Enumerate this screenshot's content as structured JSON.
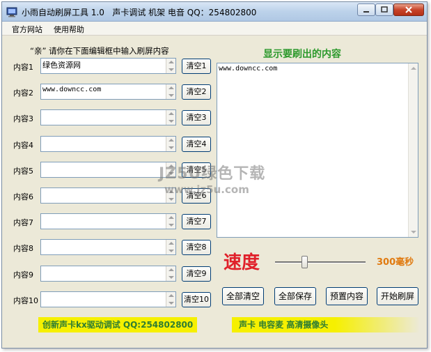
{
  "window": {
    "title": "小雨自动刷屏工具 1.0   声卡调试 机架 电音 QQ：254802800"
  },
  "menu": [
    {
      "label": "官方网站"
    },
    {
      "label": "使用帮助"
    }
  ],
  "prompt": "“亲” 请你在下面编辑框中输入刷屏内容",
  "rows": [
    {
      "label": "内容1",
      "value": "绿色资源网",
      "clear": "清空1"
    },
    {
      "label": "内容2",
      "value": "www.downcc.com",
      "clear": "清空2"
    },
    {
      "label": "内容3",
      "value": "",
      "clear": "清空3"
    },
    {
      "label": "内容4",
      "value": "",
      "clear": "清空4"
    },
    {
      "label": "内容5",
      "value": "",
      "clear": "清空5"
    },
    {
      "label": "内容6",
      "value": "",
      "clear": "清空6"
    },
    {
      "label": "内容7",
      "value": "",
      "clear": "清空7"
    },
    {
      "label": "内容8",
      "value": "",
      "clear": "清空8"
    },
    {
      "label": "内容9",
      "value": "",
      "clear": "清空9"
    },
    {
      "label": "内容10",
      "value": "",
      "clear": "清空10"
    }
  ],
  "display": {
    "title": "显示要刷出的内容",
    "text": "www.downcc.com"
  },
  "speed": {
    "label": "速度",
    "value_text": "300毫秒",
    "slider_fraction": 0.32
  },
  "actions": {
    "clear_all": "全部清空",
    "save_all": "全部保存",
    "preset": "预置内容",
    "start": "开始刷屏"
  },
  "banners": {
    "left": "创新声卡kx驱动调试 QQ:254802800",
    "right": "声卡 电容麦 高清摄像头"
  },
  "watermark": {
    "line1": "JZ5U绿色下载",
    "line2": "www.jz5u.com"
  },
  "colors": {
    "display_title": "#2d9a2d",
    "speed_label": "#e0202a",
    "speed_value": "#e07a10",
    "banner_bg": "#f6f000"
  }
}
